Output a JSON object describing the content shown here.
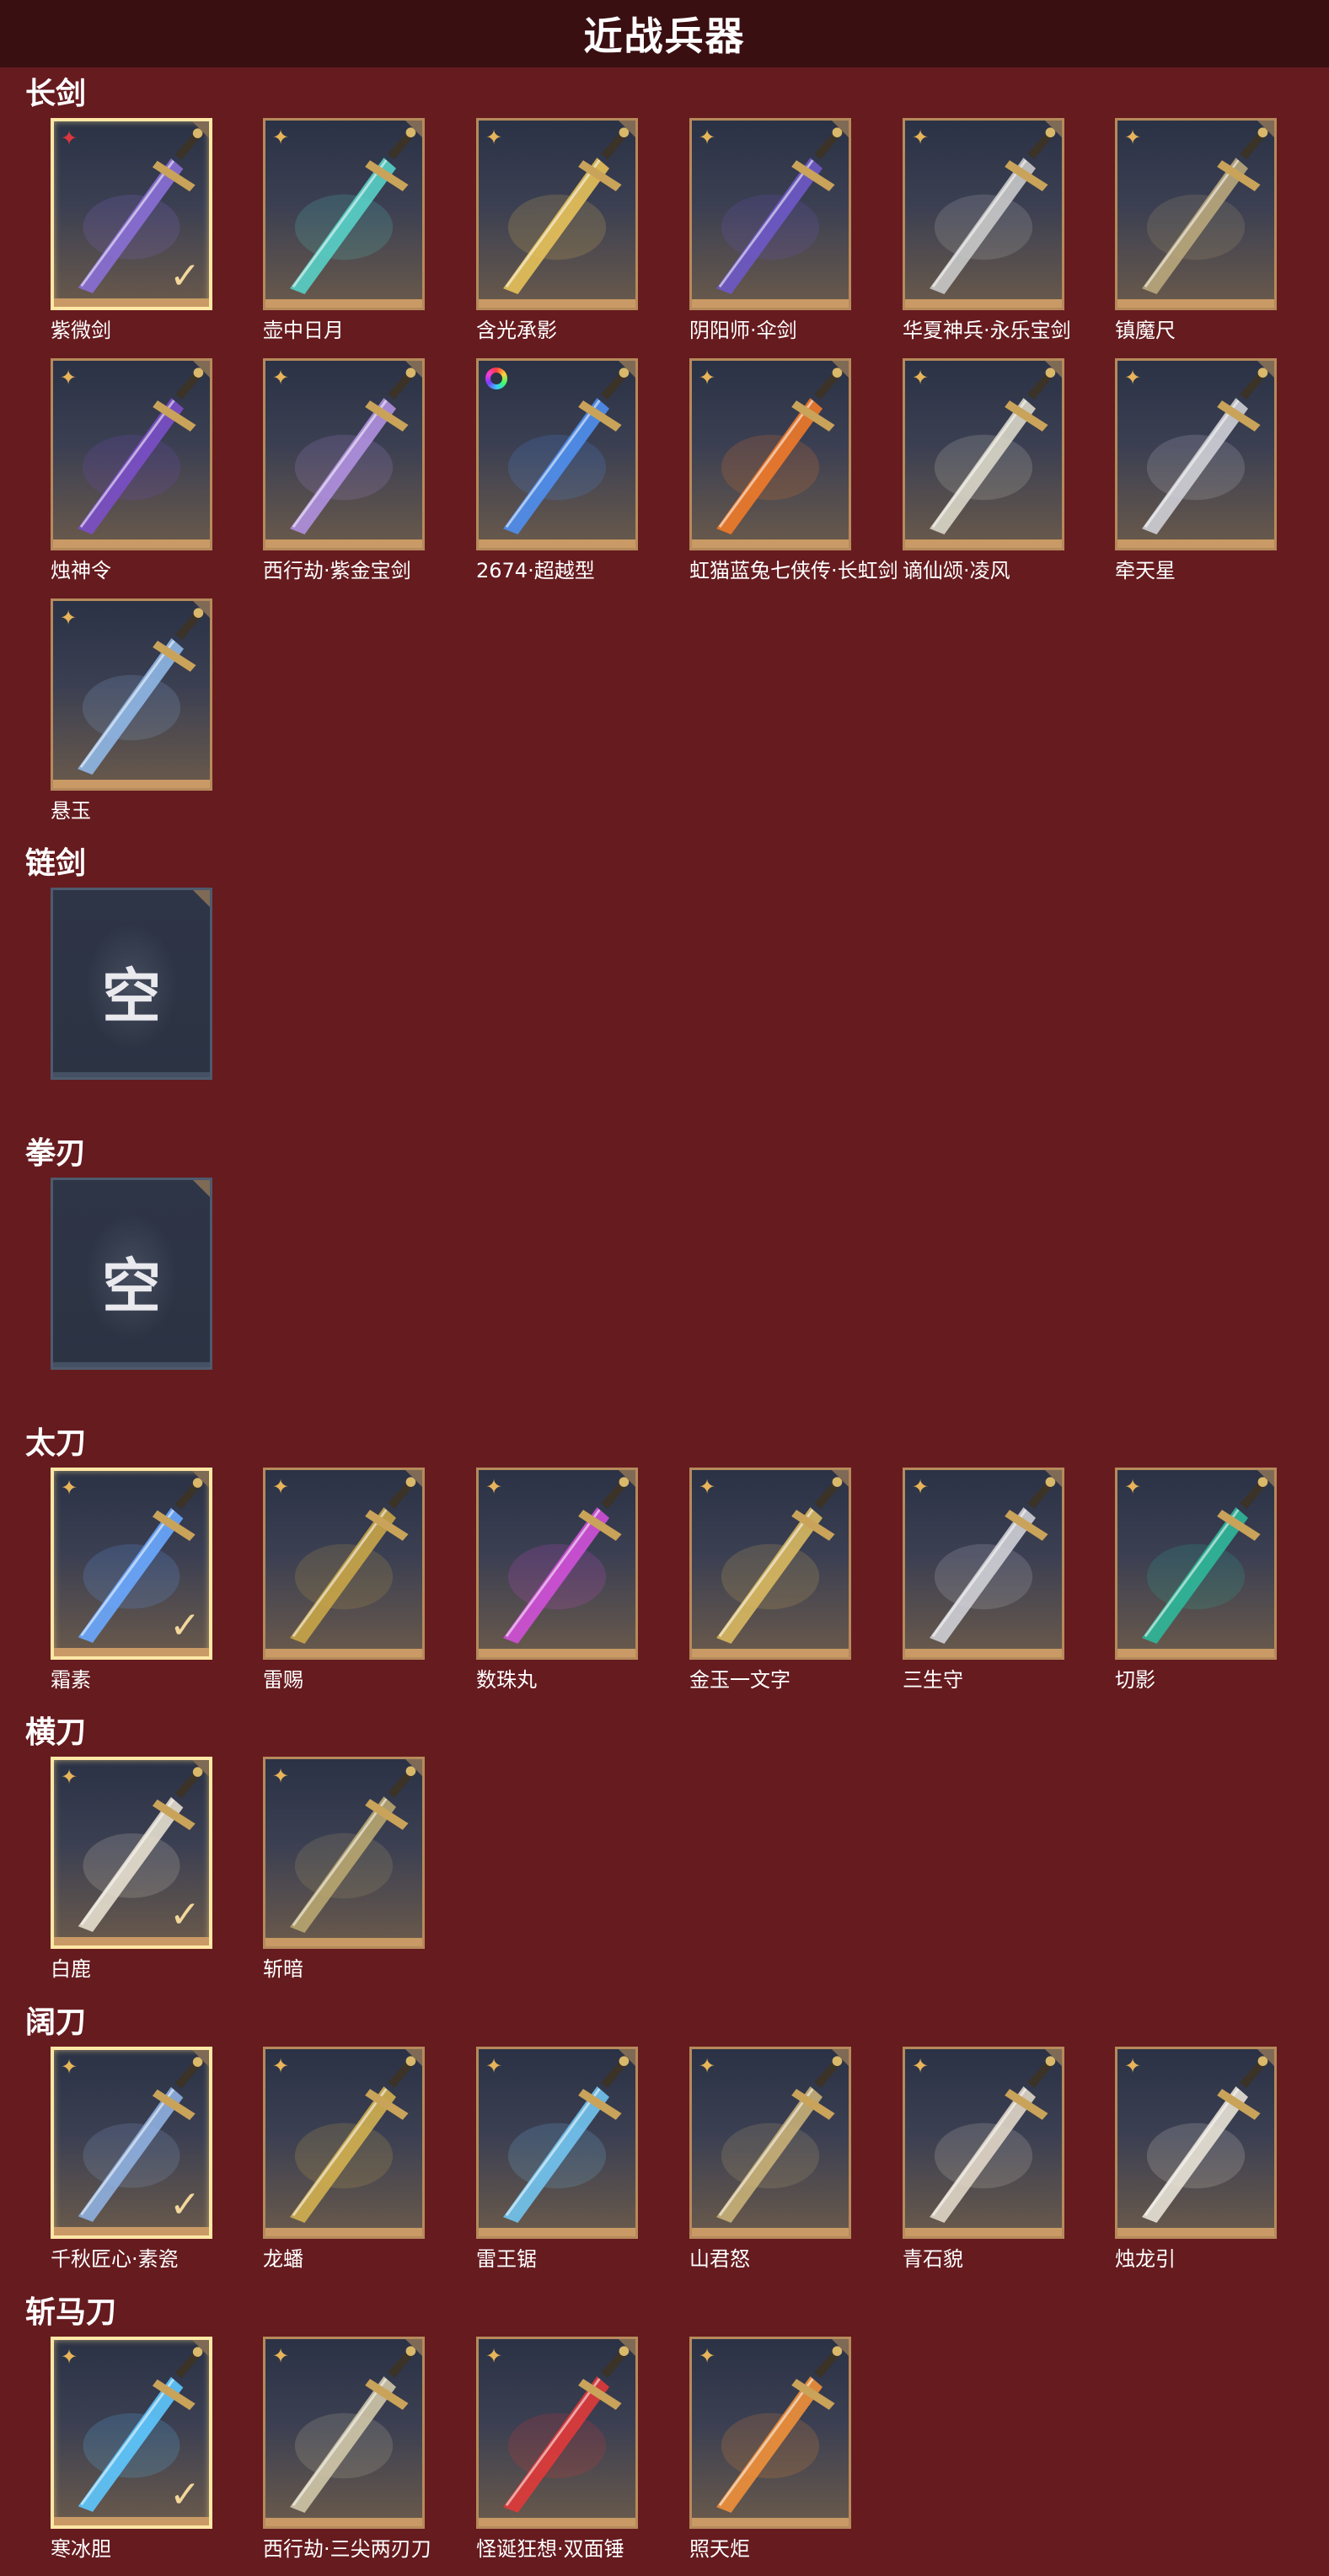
{
  "header": {
    "title": "近战兵器"
  },
  "colors": {
    "background": "#661b1f",
    "header": "#3a0f12",
    "card_border": "#b68a5b",
    "selected_border": "#ffe7a6",
    "rarity_gold": "#e7b45a",
    "rarity_red": "#d9363e"
  },
  "empty_label": "空",
  "sections": [
    {
      "title": "长剑",
      "items": [
        {
          "name": "紫微剑",
          "rarity": "red-star",
          "selected": true,
          "blade": "#8a6fd6"
        },
        {
          "name": "壶中日月",
          "rarity": "gold-star",
          "selected": false,
          "blade": "#58d0c6"
        },
        {
          "name": "含光承影",
          "rarity": "gold-star",
          "selected": false,
          "blade": "#e7c25a"
        },
        {
          "name": "阴阳师·伞剑",
          "rarity": "gold-star",
          "selected": false,
          "blade": "#6e59c8"
        },
        {
          "name": "华夏神兵·永乐宝剑",
          "rarity": "gold-star",
          "selected": false,
          "blade": "#c9c9c9"
        },
        {
          "name": "镇魔尺",
          "rarity": "gold-star",
          "selected": false,
          "blade": "#b9a77c"
        },
        {
          "name": "烛神令",
          "rarity": "gold-star",
          "selected": false,
          "blade": "#7b4fc8"
        },
        {
          "name": "西行劫·紫金宝剑",
          "rarity": "gold-star",
          "selected": false,
          "blade": "#b090e0"
        },
        {
          "name": "2674·超越型",
          "rarity": "rainbow",
          "selected": false,
          "blade": "#4f8ff0"
        },
        {
          "name": "虹猫蓝兔七侠传·长虹剑",
          "rarity": "gold-star",
          "selected": false,
          "blade": "#f07a2a"
        },
        {
          "name": "谪仙颂·凌风",
          "rarity": "gold-star",
          "selected": false,
          "blade": "#d9d6c8"
        },
        {
          "name": "牵天星",
          "rarity": "gold-star",
          "selected": false,
          "blade": "#cfcfd6"
        },
        {
          "name": "悬玉",
          "rarity": "gold-star",
          "selected": false,
          "blade": "#8fb7e6"
        }
      ]
    },
    {
      "title": "链剑",
      "items": [
        {
          "empty": true
        }
      ]
    },
    {
      "title": "拳刃",
      "items": [
        {
          "empty": true
        }
      ]
    },
    {
      "title": "太刀",
      "items": [
        {
          "name": "霜素",
          "rarity": "gold-star",
          "selected": true,
          "blade": "#6aa8ff"
        },
        {
          "name": "雷赐",
          "rarity": "gold-star",
          "selected": false,
          "blade": "#c8a548"
        },
        {
          "name": "数珠丸",
          "rarity": "gold-star",
          "selected": false,
          "blade": "#d050d8"
        },
        {
          "name": "金玉一文字",
          "rarity": "gold-star",
          "selected": false,
          "blade": "#d8b860"
        },
        {
          "name": "三生守",
          "rarity": "gold-star",
          "selected": false,
          "blade": "#cfcfd6"
        },
        {
          "name": "切影",
          "rarity": "gold-star",
          "selected": false,
          "blade": "#2fb89a"
        }
      ]
    },
    {
      "title": "横刀",
      "items": [
        {
          "name": "白鹿",
          "rarity": "gold-star",
          "selected": true,
          "blade": "#e6dfcf"
        },
        {
          "name": "斩暗",
          "rarity": "gold-star",
          "selected": false,
          "blade": "#b8a670"
        }
      ]
    },
    {
      "title": "阔刀",
      "items": [
        {
          "name": "千秋匠心·素瓷",
          "rarity": "gold-star",
          "selected": true,
          "blade": "#8fb0e0"
        },
        {
          "name": "龙蟠",
          "rarity": "gold-star",
          "selected": false,
          "blade": "#d2b050"
        },
        {
          "name": "雷王锯",
          "rarity": "gold-star",
          "selected": false,
          "blade": "#72c4f0"
        },
        {
          "name": "山君怒",
          "rarity": "gold-star",
          "selected": false,
          "blade": "#c8b078"
        },
        {
          "name": "青石貌",
          "rarity": "gold-star",
          "selected": false,
          "blade": "#e0d6c6"
        },
        {
          "name": "烛龙引",
          "rarity": "gold-star",
          "selected": false,
          "blade": "#e8e2d6"
        }
      ]
    },
    {
      "title": "斩马刀",
      "items": [
        {
          "name": "寒冰胆",
          "rarity": "gold-star",
          "selected": true,
          "blade": "#5ec8ff"
        },
        {
          "name": "西行劫·三尖两刃刀",
          "rarity": "gold-star",
          "selected": false,
          "blade": "#cfc6a8"
        },
        {
          "name": "怪诞狂想·双面锤",
          "rarity": "gold-star",
          "selected": false,
          "blade": "#e03a3a"
        },
        {
          "name": "照天炬",
          "rarity": "gold-star",
          "selected": false,
          "blade": "#f0903a"
        }
      ]
    }
  ]
}
